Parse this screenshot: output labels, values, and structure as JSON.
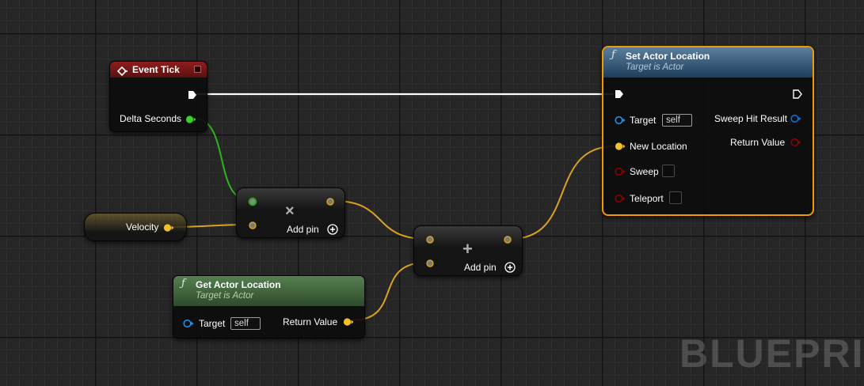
{
  "watermark": "BLUEPRI",
  "event_tick": {
    "title": "Event Tick",
    "delta_seconds_label": "Delta Seconds"
  },
  "velocity": {
    "label": "Velocity"
  },
  "multiply_node": {
    "symbol": "×",
    "add_pin_label": "Add pin"
  },
  "add_node": {
    "symbol": "+",
    "add_pin_label": "Add pin"
  },
  "get_actor_location": {
    "title": "Get Actor Location",
    "subtitle": "Target is Actor",
    "target_label": "Target",
    "target_value": "self",
    "return_label": "Return Value"
  },
  "set_actor_location": {
    "title": "Set Actor Location",
    "subtitle": "Target is Actor",
    "target_label": "Target",
    "target_value": "self",
    "new_location_label": "New Location",
    "sweep_label": "Sweep",
    "teleport_label": "Teleport",
    "sweep_hit_result_label": "Sweep Hit Result",
    "return_label": "Return Value"
  },
  "colors": {
    "exec": "#ffffff",
    "float": "#3ad02a",
    "vector": "#f4c02c",
    "object": "#1f8fe8",
    "struct": "#0a5fc0",
    "bool": "#8e0000",
    "selection": "#f39a00",
    "event_header": "#7a1616",
    "function_header": "#2c5a86",
    "pure_function_header": "#3f6a3c"
  },
  "icons": {
    "function": "function-f-icon",
    "event": "event-diamond-icon",
    "multiply": "multiply-icon",
    "add": "plus-icon",
    "add_pin": "add-pin-circle-icon"
  }
}
